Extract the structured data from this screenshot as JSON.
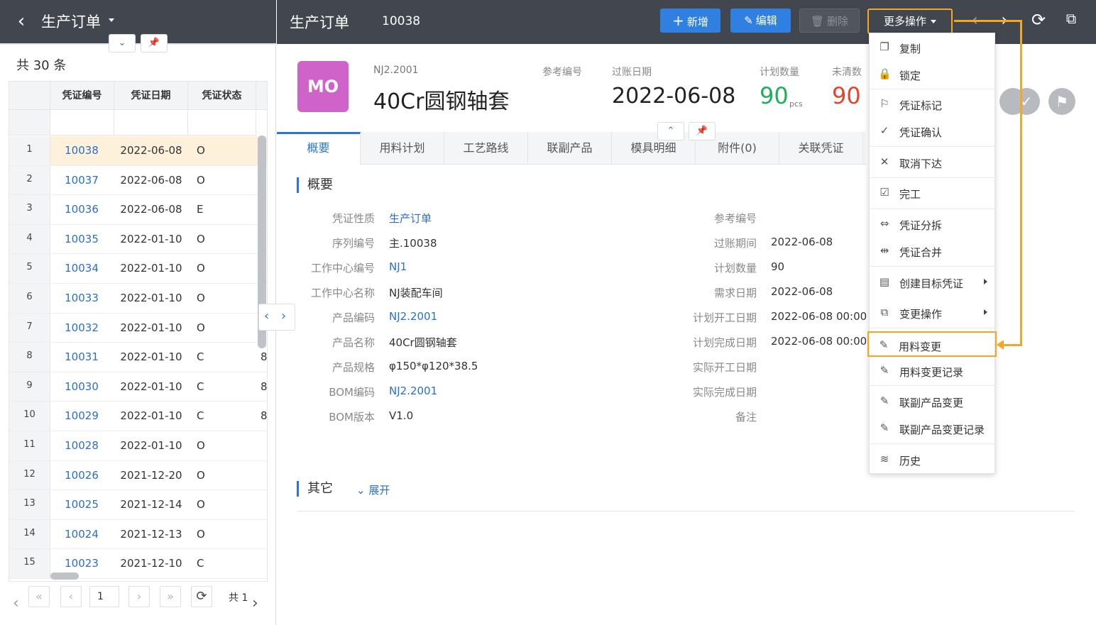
{
  "left": {
    "back_icon": "chevron-left-icon",
    "title": "生产订单",
    "count_text": "共 30 条",
    "columns": [
      "凭证编号",
      "凭证日期",
      "凭证状态"
    ],
    "rows": [
      {
        "num": "1",
        "code": "10038",
        "date": "2022-06-08",
        "status": "O",
        "extra": ""
      },
      {
        "num": "2",
        "code": "10037",
        "date": "2022-06-08",
        "status": "O",
        "extra": ""
      },
      {
        "num": "3",
        "code": "10036",
        "date": "2022-06-08",
        "status": "E",
        "extra": ""
      },
      {
        "num": "4",
        "code": "10035",
        "date": "2022-01-10",
        "status": "O",
        "extra": ""
      },
      {
        "num": "5",
        "code": "10034",
        "date": "2022-01-10",
        "status": "O",
        "extra": ""
      },
      {
        "num": "6",
        "code": "10033",
        "date": "2022-01-10",
        "status": "O",
        "extra": ""
      },
      {
        "num": "7",
        "code": "10032",
        "date": "2022-01-10",
        "status": "O",
        "extra": ""
      },
      {
        "num": "8",
        "code": "10031",
        "date": "2022-01-10",
        "status": "C",
        "extra": "8"
      },
      {
        "num": "9",
        "code": "10030",
        "date": "2022-01-10",
        "status": "C",
        "extra": "8"
      },
      {
        "num": "10",
        "code": "10029",
        "date": "2022-01-10",
        "status": "C",
        "extra": "8"
      },
      {
        "num": "11",
        "code": "10028",
        "date": "2022-01-10",
        "status": "O",
        "extra": ""
      },
      {
        "num": "12",
        "code": "10026",
        "date": "2021-12-20",
        "status": "O",
        "extra": ""
      },
      {
        "num": "13",
        "code": "10025",
        "date": "2021-12-14",
        "status": "O",
        "extra": ""
      },
      {
        "num": "14",
        "code": "10024",
        "date": "2021-12-13",
        "status": "O",
        "extra": ""
      },
      {
        "num": "15",
        "code": "10023",
        "date": "2021-12-10",
        "status": "C",
        "extra": ""
      }
    ],
    "pager": {
      "first": "«",
      "prev": "‹",
      "page": "1",
      "next": "›",
      "last": "»",
      "total_text": "共 1"
    }
  },
  "topbar": {
    "title": "生产订单",
    "doc_code": "10038",
    "btn_new": "新增",
    "btn_edit": "编辑",
    "btn_delete": "删除",
    "btn_more": "更多操作"
  },
  "header": {
    "badge": "MO",
    "product_code": "NJ2.2001",
    "product_name": "40Cr圆钢轴套",
    "ref_label": "参考编号",
    "date_label": "过账日期",
    "date_value": "2022-06-08",
    "plan_label": "计划数量",
    "plan_value": "90",
    "plan_unit": "pcs",
    "open_label": "未清数",
    "open_value": "90"
  },
  "tabs": [
    "概要",
    "用料计划",
    "工艺路线",
    "联副产品",
    "模具明细",
    "附件(0)",
    "关联凭证"
  ],
  "overview": {
    "section_title": "概要",
    "left_fields": [
      {
        "label": "凭证性质",
        "value": "生产订单",
        "link": true
      },
      {
        "label": "序列编号",
        "value": "主.10038",
        "link": false
      },
      {
        "label": "工作中心编号",
        "value": "NJ1",
        "link": true
      },
      {
        "label": "工作中心名称",
        "value": "NJ装配车间",
        "link": false
      },
      {
        "label": "产品编码",
        "value": "NJ2.2001",
        "link": true
      },
      {
        "label": "产品名称",
        "value": "40Cr圆钢轴套",
        "link": false
      },
      {
        "label": "产品规格",
        "value": "φ150*φ120*38.5",
        "link": false
      },
      {
        "label": "BOM编码",
        "value": "NJ2.2001",
        "link": true
      },
      {
        "label": "BOM版本",
        "value": "V1.0",
        "link": false
      }
    ],
    "right_fields": [
      {
        "label": "参考编号",
        "value": ""
      },
      {
        "label": "过账期间",
        "value": "2022-06-08"
      },
      {
        "label": "计划数量",
        "value": "90"
      },
      {
        "label": "需求日期",
        "value": "2022-06-08"
      },
      {
        "label": "计划开工日期",
        "value": "2022-06-08 00:00"
      },
      {
        "label": "计划完成日期",
        "value": "2022-06-08 00:00"
      },
      {
        "label": "实际开工日期",
        "value": ""
      },
      {
        "label": "实际完成日期",
        "value": ""
      },
      {
        "label": "备注",
        "value": ""
      }
    ],
    "other_title": "其它",
    "expand_label": "展开"
  },
  "menu": {
    "items": [
      {
        "label": "复制",
        "icon": "copy-icon",
        "glyph": "❐"
      },
      {
        "label": "锁定",
        "icon": "lock-icon",
        "glyph": "🔒"
      },
      {
        "label": "凭证标记",
        "icon": "flag-icon",
        "glyph": "⚐"
      },
      {
        "label": "凭证确认",
        "icon": "check-circle-icon",
        "glyph": "✓"
      },
      {
        "label": "取消下达",
        "icon": "close-icon",
        "glyph": "✕"
      },
      {
        "label": "完工",
        "icon": "complete-doc-icon",
        "glyph": "☑"
      },
      {
        "label": "凭证分拆",
        "icon": "split-icon",
        "glyph": "⇔"
      },
      {
        "label": "凭证合并",
        "icon": "merge-icon",
        "glyph": "⇹"
      },
      {
        "label": "创建目标凭证",
        "icon": "document-icon",
        "glyph": "▤",
        "submenu": true
      },
      {
        "label": "变更操作",
        "icon": "change-icon",
        "glyph": "⧉",
        "submenu": true
      },
      {
        "label": "用料变更",
        "icon": "material-change-icon",
        "glyph": "✎",
        "highlight": true
      },
      {
        "label": "用料变更记录",
        "icon": "material-log-icon",
        "glyph": "✎"
      },
      {
        "label": "联副产品变更",
        "icon": "coproduct-change-icon",
        "glyph": "✎"
      },
      {
        "label": "联副产品变更记录",
        "icon": "coproduct-log-icon",
        "glyph": "✎"
      },
      {
        "label": "历史",
        "icon": "history-layers-icon",
        "glyph": "≋"
      }
    ]
  },
  "colors": {
    "accent": "#2a76d2",
    "highlight": "#f6a623",
    "badge": "#cf63c9",
    "plan_green": "#1fae5b",
    "open_red": "#e0462b",
    "topbar": "#41464f"
  }
}
